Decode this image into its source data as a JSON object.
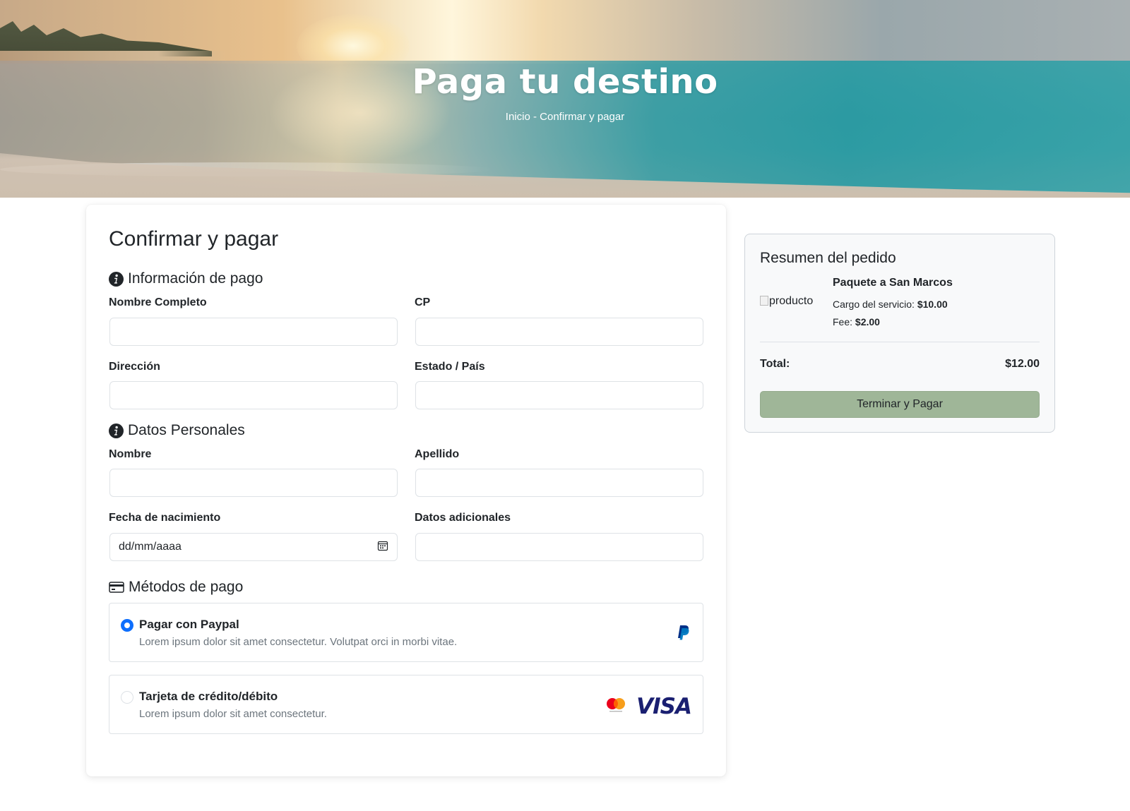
{
  "hero": {
    "title": "Paga tu destino",
    "breadcrumb_home": "Inicio",
    "breadcrumb_sep": " - ",
    "breadcrumb_current": "Confirmar y pagar"
  },
  "form": {
    "title": "Confirmar y pagar",
    "payment_info": {
      "heading": "Información de pago",
      "full_name_label": "Nombre Completo",
      "full_name_value": "",
      "cp_label": "CP",
      "cp_value": "",
      "address_label": "Dirección",
      "address_value": "",
      "state_country_label": "Estado / País",
      "state_country_value": ""
    },
    "personal": {
      "heading": "Datos Personales",
      "first_name_label": "Nombre",
      "first_name_value": "",
      "last_name_label": "Apellido",
      "last_name_value": "",
      "birthdate_label": "Fecha de nacimiento",
      "birthdate_placeholder": "dd/mm/aaaa",
      "extra_label": "Datos adicionales",
      "extra_value": ""
    },
    "methods": {
      "heading": "Métodos de pago",
      "options": [
        {
          "title": "Pagar con Paypal",
          "desc": "Lorem ipsum dolor sit amet consectetur. Volutpat orci in morbi vitae.",
          "selected": true,
          "icon": "paypal-icon"
        },
        {
          "title": "Tarjeta de crédito/débito",
          "desc": "Lorem ipsum dolor sit amet consectetur.",
          "selected": false,
          "icons": [
            "mastercard-icon",
            "visa-icon"
          ],
          "visa_text": "VISA"
        }
      ]
    }
  },
  "summary": {
    "title": "Resumen del pedido",
    "image_alt": "producto",
    "product_name": "Paquete a San Marcos",
    "service_label": "Cargo del servicio: ",
    "service_value": "$10.00",
    "fee_label": "Fee: ",
    "fee_value": "$2.00",
    "total_label": "Total:",
    "total_value": "$12.00",
    "button_label": "Terminar y Pagar"
  },
  "colors": {
    "accent_radio": "#0d6efd",
    "pay_button": "#9fb698",
    "paypal_dark": "#003087",
    "paypal_light": "#0079c1",
    "visa_blue": "#1a1f71"
  }
}
